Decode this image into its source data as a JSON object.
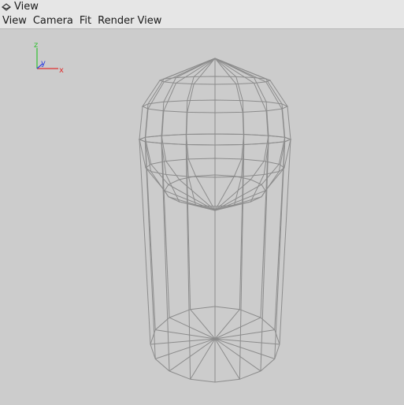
{
  "window": {
    "title": "View",
    "icon": "view-icon"
  },
  "menubar": {
    "items": [
      "View",
      "Camera",
      "Fit",
      "Render View"
    ]
  },
  "viewport": {
    "axes": {
      "x_label": "x",
      "y_label": "y",
      "z_label": "z"
    },
    "model": "wireframe-capsule-cylinder",
    "colors": {
      "background": "#cccccc",
      "wire": "#8c8c8c",
      "x_axis": "#e03030",
      "y_axis": "#3040e0",
      "z_axis": "#30c030"
    }
  }
}
